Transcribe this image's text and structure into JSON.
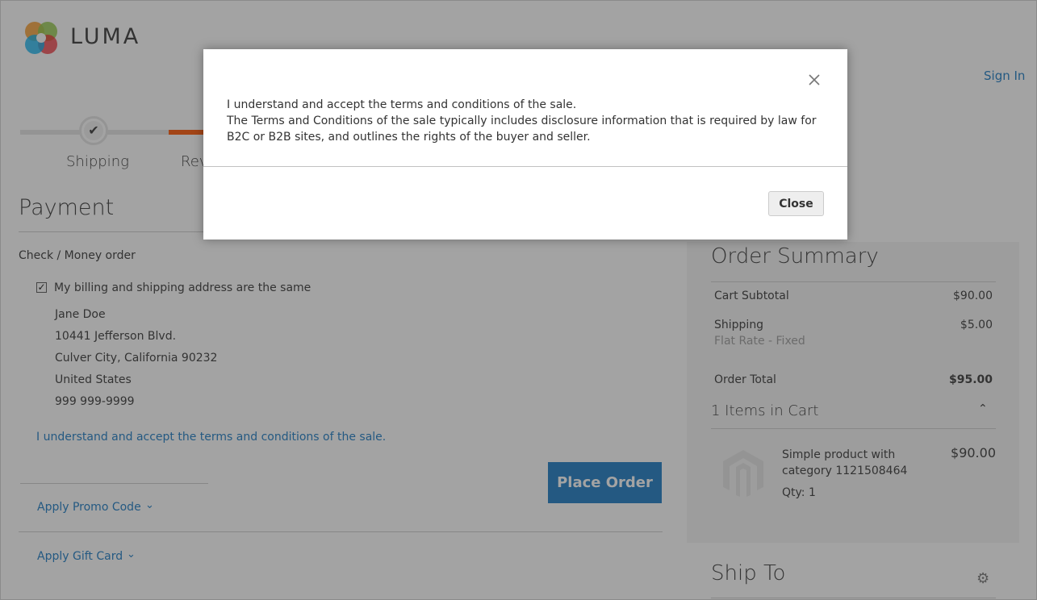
{
  "header": {
    "logo_text": "LUMA",
    "sign_in": "Sign In"
  },
  "progress": {
    "steps": [
      {
        "label": "Shipping",
        "state": "complete"
      },
      {
        "label": "Review & Payments",
        "visible_label": "Rev",
        "state": "active"
      }
    ],
    "accent_color": "#ff5501"
  },
  "payment": {
    "title": "Payment",
    "method": "Check / Money order",
    "same_address_label": "My billing and shipping address are the same",
    "same_address_checked": true,
    "address": [
      "Jane Doe",
      "10441 Jefferson Blvd.",
      "Culver City, California 90232",
      "United States",
      "999 999-9999"
    ],
    "terms_link": "I understand and accept the terms and conditions of the sale.",
    "place_order": "Place Order",
    "promo": "Apply Promo Code",
    "gift": "Apply Gift Card"
  },
  "summary": {
    "title": "Order Summary",
    "subtotal_label": "Cart Subtotal",
    "subtotal_value": "$90.00",
    "shipping_label": "Shipping",
    "shipping_value": "$5.00",
    "shipping_method": "Flat Rate - Fixed",
    "total_label": "Order Total",
    "total_value": "$95.00",
    "items_title": "1 Items in Cart",
    "product": {
      "name": "Simple product with category 1121508464",
      "price": "$90.00",
      "qty": "Qty: 1"
    },
    "ship_to": "Ship To"
  },
  "modal": {
    "line1": "I understand and accept the terms and conditions of the sale.",
    "line2": "The Terms and Conditions of the sale typically includes disclosure information that is required by law for B2C or B2B sites, and outlines the rights of the buyer and seller.",
    "close_button": "Close"
  },
  "colors": {
    "link": "#1979c3",
    "primary_button": "#1979c3"
  }
}
